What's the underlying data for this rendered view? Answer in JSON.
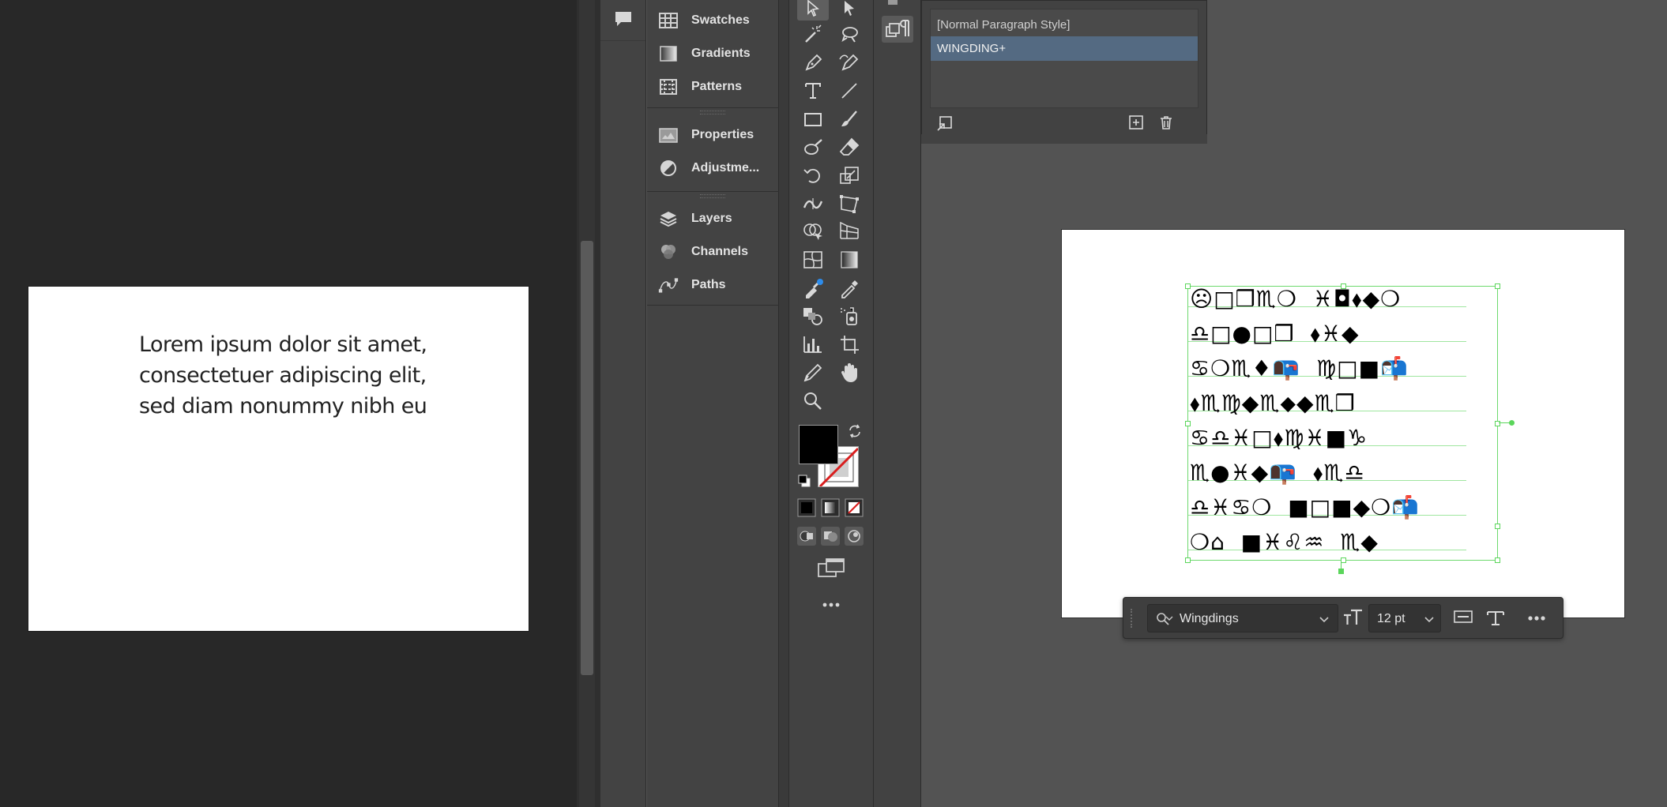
{
  "preview": {
    "text": "Lorem ipsum dolor sit amet, consectetuer adipiscing elit, sed diam nonummy nibh eu"
  },
  "panels": {
    "group1": [
      {
        "label": "Swatches",
        "icon": "swatches-icon"
      },
      {
        "label": "Gradients",
        "icon": "gradients-icon"
      },
      {
        "label": "Patterns",
        "icon": "patterns-icon"
      }
    ],
    "group2": [
      {
        "label": "Properties",
        "icon": "properties-icon"
      },
      {
        "label": "Adjustme...",
        "icon": "adjustments-icon"
      }
    ],
    "group3": [
      {
        "label": "Layers",
        "icon": "layers-icon"
      },
      {
        "label": "Channels",
        "icon": "channels-icon"
      },
      {
        "label": "Paths",
        "icon": "paths-icon"
      }
    ]
  },
  "paragraph_styles": {
    "items": [
      "[Normal Paragraph Style]",
      "WINGDING+"
    ],
    "selected_index": 1
  },
  "wingdings_text": {
    "lines": [
      "☹□❒♏❍  ♓◘⬧◆❍",
      "♎□●□❒  ⬧♓◆",
      "♋❍♏♦📭  ♍□■📬",
      "⬧♏♍◆♏⬥◆♏❒",
      "♋♎♓□⬧♍♓■♑",
      "♏●♓◆📭  ⬧♏♎",
      "♎♓♋❍  ■□■◆❍📬",
      "❍⌂  ■♓♌♒  ♏◆"
    ]
  },
  "context_bar": {
    "font": "Wingdings",
    "size": "12 pt"
  },
  "colors": {
    "selection_green": "#5bd65b",
    "selected_row": "#546a82",
    "accent_blue": "#2d8ceb"
  }
}
